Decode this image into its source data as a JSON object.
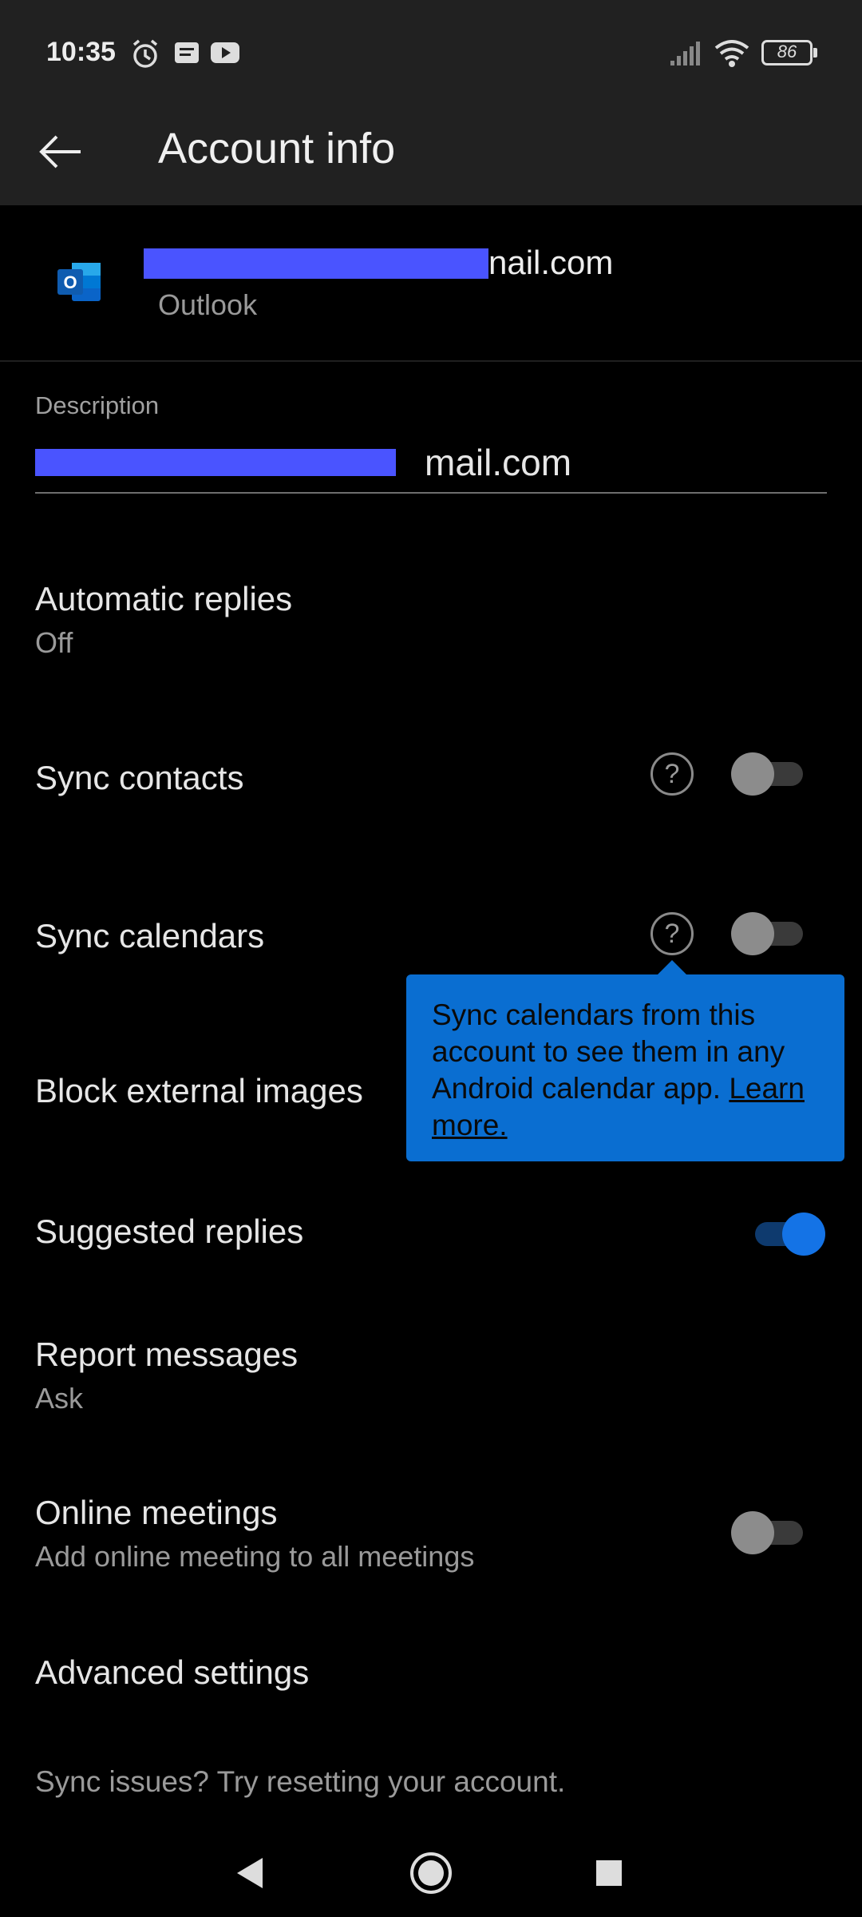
{
  "status_bar": {
    "time": "10:35",
    "battery": "86",
    "icons": [
      "alarm-icon",
      "notes-icon",
      "youtube-icon",
      "signal-icon",
      "wifi-icon",
      "battery-icon"
    ]
  },
  "app_bar": {
    "title": "Account info",
    "back_icon": "arrow-left-icon"
  },
  "account": {
    "email_visible_suffix": "nail.com",
    "type": "Outlook",
    "logo_letter": "O"
  },
  "description": {
    "label": "Description",
    "value_visible_suffix": "mail.com"
  },
  "settings": [
    {
      "key": "automatic_replies",
      "title": "Automatic replies",
      "subtitle": "Off"
    },
    {
      "key": "sync_contacts",
      "title": "Sync contacts",
      "help": "?",
      "toggle": false
    },
    {
      "key": "sync_calendars",
      "title": "Sync calendars",
      "help": "?",
      "toggle": false
    },
    {
      "key": "block_external_images",
      "title": "Block external images"
    },
    {
      "key": "suggested_replies",
      "title": "Suggested replies",
      "toggle": true
    },
    {
      "key": "report_messages",
      "title": "Report messages",
      "subtitle": "Ask"
    },
    {
      "key": "online_meetings",
      "title": "Online meetings",
      "subtitle": "Add online meeting to all meetings",
      "toggle": false
    },
    {
      "key": "advanced_settings",
      "title": "Advanced settings"
    }
  ],
  "tooltip": {
    "text": "Sync calendars from this account to see them in any Android calendar app.",
    "link": "Learn more."
  },
  "footer": {
    "text": "Sync issues? Try resetting your account."
  },
  "nav_bar": {
    "icons": [
      "back-triangle-icon",
      "home-circle-icon",
      "recents-square-icon"
    ]
  },
  "colors": {
    "accent": "#1473e6",
    "tooltip_bg": "#0a6ed1",
    "bar_bg": "#212121",
    "redaction": "#4a54ff"
  }
}
